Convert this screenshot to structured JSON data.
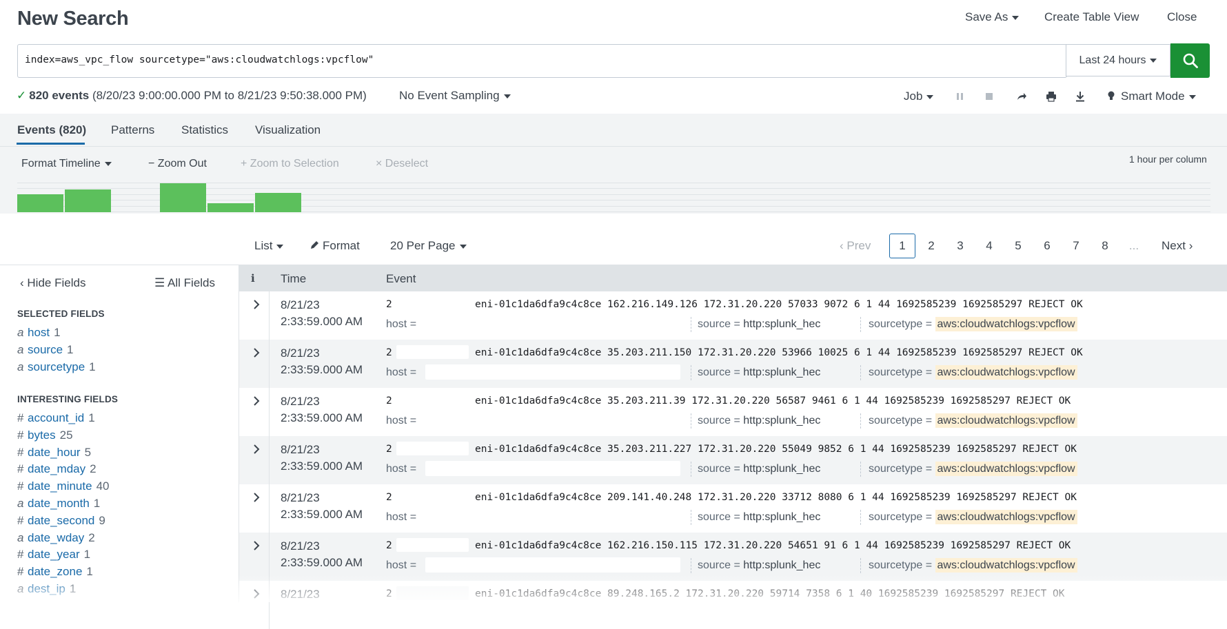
{
  "header": {
    "title": "New Search",
    "save_as": "Save As",
    "create_table_view": "Create Table View",
    "close": "Close"
  },
  "search": {
    "query": "index=aws_vpc_flow sourcetype=\"aws:cloudwatchlogs:vpcflow\"",
    "time_range": "Last 24 hours"
  },
  "status": {
    "count": "820 events",
    "range": "(8/20/23 9:00:00.000 PM to 8/21/23 9:50:38.000 PM)",
    "sampling": "No Event Sampling",
    "job": "Job",
    "mode": "Smart Mode"
  },
  "tabs": [
    "Events (820)",
    "Patterns",
    "Statistics",
    "Visualization"
  ],
  "timeline": {
    "format": "Format Timeline",
    "zoom_out": "Zoom Out",
    "zoom_selection": "Zoom to Selection",
    "deselect": "Deselect",
    "per_column": "1 hour per column",
    "bars": [
      {
        "col": 0,
        "level": 0.62
      },
      {
        "col": 1,
        "level": 0.78
      },
      {
        "col": 3,
        "level": 1.0
      },
      {
        "col": 4,
        "level": 0.3
      },
      {
        "col": 5,
        "level": 0.66
      }
    ]
  },
  "results_controls": {
    "list": "List",
    "format": "Format",
    "per_page": "20 Per Page",
    "prev": "Prev",
    "pages": [
      "1",
      "2",
      "3",
      "4",
      "5",
      "6",
      "7",
      "8",
      "..."
    ],
    "next": "Next"
  },
  "sidebar": {
    "hide_fields": "Hide Fields",
    "all_fields": "All Fields",
    "selected_heading": "SELECTED FIELDS",
    "selected": [
      {
        "type": "a",
        "name": "host",
        "count": "1"
      },
      {
        "type": "a",
        "name": "source",
        "count": "1"
      },
      {
        "type": "a",
        "name": "sourcetype",
        "count": "1"
      }
    ],
    "interesting_heading": "INTERESTING FIELDS",
    "interesting": [
      {
        "type": "#",
        "name": "account_id",
        "count": "1"
      },
      {
        "type": "#",
        "name": "bytes",
        "count": "25"
      },
      {
        "type": "#",
        "name": "date_hour",
        "count": "5"
      },
      {
        "type": "#",
        "name": "date_mday",
        "count": "2"
      },
      {
        "type": "#",
        "name": "date_minute",
        "count": "40"
      },
      {
        "type": "a",
        "name": "date_month",
        "count": "1"
      },
      {
        "type": "#",
        "name": "date_second",
        "count": "9"
      },
      {
        "type": "a",
        "name": "date_wday",
        "count": "2"
      },
      {
        "type": "#",
        "name": "date_year",
        "count": "1"
      },
      {
        "type": "#",
        "name": "date_zone",
        "count": "1"
      },
      {
        "type": "a",
        "name": "dest_ip",
        "count": "1"
      }
    ]
  },
  "table": {
    "col_info": "i",
    "col_time": "Time",
    "col_event": "Event",
    "meta_host": "host =",
    "meta_source": "source =",
    "meta_sourcetype": "sourcetype =",
    "source_value": "http:splunk_hec",
    "sourcetype_value": "aws:cloudwatchlogs:vpcflow",
    "rows": [
      {
        "date": "8/21/23",
        "time": "2:33:59.000 AM",
        "lead": "2",
        "event": "eni-01c1da6dfa9c4c8ce 162.216.149.126 172.31.20.220 57033 9072 6 1 44 1692585239 1692585297 REJECT OK"
      },
      {
        "date": "8/21/23",
        "time": "2:33:59.000 AM",
        "lead": "2",
        "event": "eni-01c1da6dfa9c4c8ce 35.203.211.150 172.31.20.220 53966 10025 6 1 44 1692585239 1692585297 REJECT OK"
      },
      {
        "date": "8/21/23",
        "time": "2:33:59.000 AM",
        "lead": "2",
        "event": "eni-01c1da6dfa9c4c8ce 35.203.211.39 172.31.20.220 56587 9461 6 1 44 1692585239 1692585297 REJECT OK"
      },
      {
        "date": "8/21/23",
        "time": "2:33:59.000 AM",
        "lead": "2",
        "event": "eni-01c1da6dfa9c4c8ce 35.203.211.227 172.31.20.220 55049 9852 6 1 44 1692585239 1692585297 REJECT OK"
      },
      {
        "date": "8/21/23",
        "time": "2:33:59.000 AM",
        "lead": "2",
        "event": "eni-01c1da6dfa9c4c8ce 209.141.40.248 172.31.20.220 33712 8080 6 1 44 1692585239 1692585297 REJECT OK"
      },
      {
        "date": "8/21/23",
        "time": "2:33:59.000 AM",
        "lead": "2",
        "event": "eni-01c1da6dfa9c4c8ce 162.216.150.115 172.31.20.220 54651 91 6 1 44 1692585239 1692585297 REJECT OK"
      },
      {
        "date": "8/21/23",
        "time": "",
        "lead": "2",
        "event": "eni-01c1da6dfa9c4c8ce 89.248.165.2 172.31.20.220 59714 7358 6 1 40 1692585239 1692585297 REJECT OK"
      }
    ]
  },
  "colors": {
    "accent": "#1a6aa8",
    "search_button": "#1a9035",
    "histogram": "#5cc05c",
    "highlight": "#fdf0d5"
  }
}
